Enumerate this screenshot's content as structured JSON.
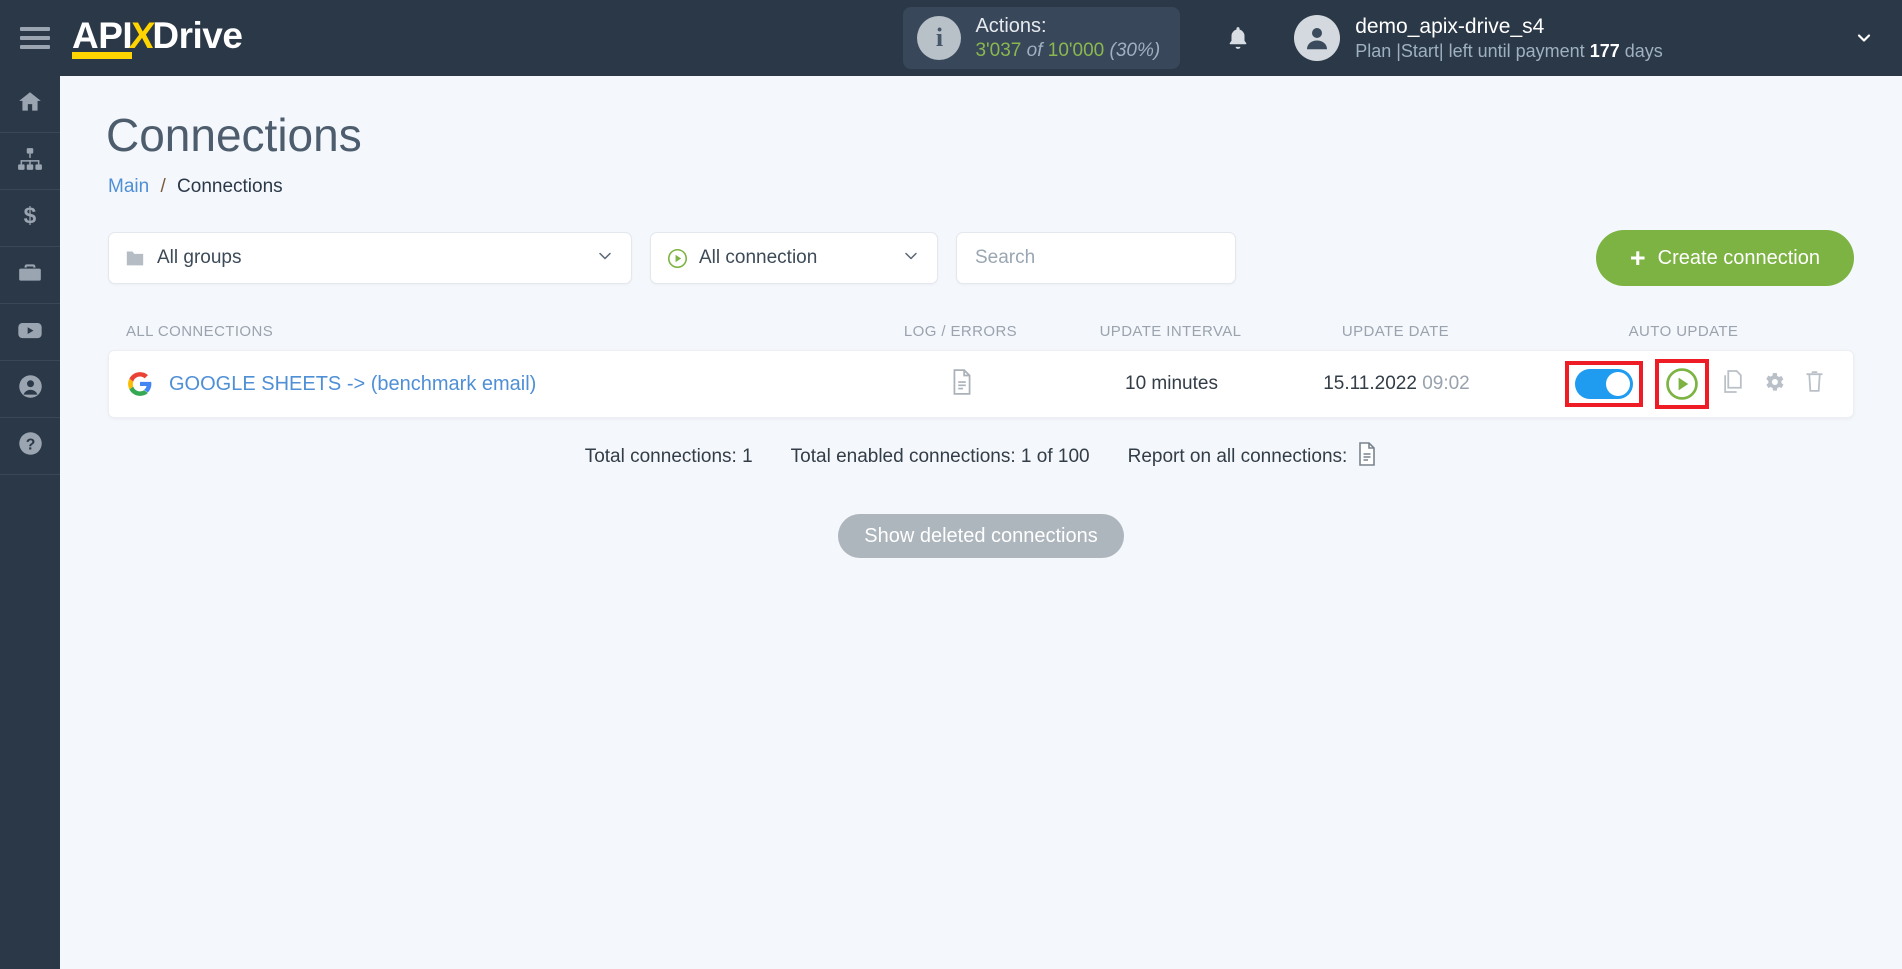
{
  "brand": {
    "name_part1": "API",
    "name_x": "X",
    "name_part2": "Drive"
  },
  "header": {
    "actions_label": "Actions:",
    "actions_used": "3'037",
    "actions_of": "of",
    "actions_total": "10'000",
    "actions_percent": "(30%)",
    "username": "demo_apix-drive_s4",
    "plan_prefix": "Plan |Start| left until payment",
    "plan_days": "177",
    "plan_suffix": "days",
    "accent_green": "#8ab84e",
    "bar_bg": "#2b3847"
  },
  "sidebar": {
    "items": [
      {
        "name": "home",
        "label": "Home"
      },
      {
        "name": "connections",
        "label": "Connections"
      },
      {
        "name": "billing",
        "label": "Billing"
      },
      {
        "name": "business",
        "label": "Business"
      },
      {
        "name": "video",
        "label": "Video"
      },
      {
        "name": "account",
        "label": "Account"
      },
      {
        "name": "help",
        "label": "Help"
      }
    ]
  },
  "page": {
    "title": "Connections",
    "breadcrumb_root": "Main",
    "breadcrumb_sep": "/",
    "breadcrumb_current": "Connections"
  },
  "filters": {
    "groups_value": "All groups",
    "connection_value": "All connection",
    "search_value": "",
    "search_placeholder": "Search",
    "create_label": "Create connection",
    "create_plus": "+",
    "create_color": "#7cb342"
  },
  "table": {
    "headers": {
      "name": "ALL CONNECTIONS",
      "log": "LOG / ERRORS",
      "interval": "UPDATE INTERVAL",
      "date": "UPDATE DATE",
      "auto": "AUTO UPDATE"
    },
    "rows": [
      {
        "name": "GOOGLE SHEETS -> (benchmark email)",
        "service_icon": "google-icon",
        "interval": "10 minutes",
        "date": "15.11.2022",
        "time": "09:02",
        "toggle_on": true,
        "highlight_color": "#ee1c25"
      }
    ]
  },
  "summary": {
    "total": "Total connections: 1",
    "enabled": "Total enabled connections: 1 of 100",
    "report": "Report on all connections:"
  },
  "footer": {
    "show_deleted": "Show deleted connections"
  }
}
